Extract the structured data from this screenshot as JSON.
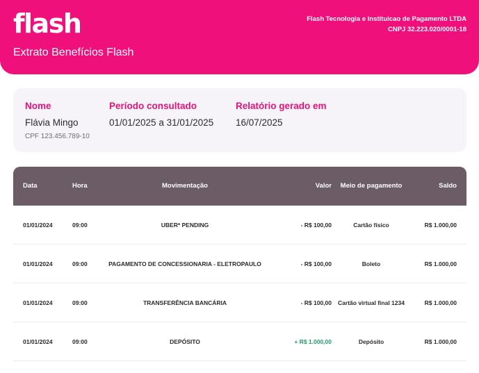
{
  "header": {
    "logo": "flash",
    "title": "Extrato Benefícios Flash",
    "company_name": "Flash Tecnologia e Instituicao de Pagamento LTDA",
    "company_cnpj": "CNPJ 32.223.020/0001-18",
    "brand_color": "#f0107c"
  },
  "info": {
    "name_label": "Nome",
    "name_value": "Flávia Mingo",
    "cpf": "CPF 123.456.789-10",
    "period_label": "Período consultado",
    "period_value": "01/01/2025 a 31/01/2025",
    "generated_label": "Relatório gerado em",
    "generated_value": "16/07/2025",
    "label_color": "#e5127a"
  },
  "table": {
    "header_color": "#6b5c66",
    "columns": [
      "Data",
      "Hora",
      "Movimentação",
      "Valor",
      "Meio de pagamento",
      "Saldo"
    ],
    "rows": [
      {
        "data": "01/01/2024",
        "hora": "09:00",
        "movimentacao": "UBER* PENDING",
        "valor": "- R$ 100,00",
        "meio": "Cartão físico",
        "saldo": "R$ 1.000,00"
      },
      {
        "data": "01/01/2024",
        "hora": "09:00",
        "movimentacao": "PAGAMENTO DE CONCESSIONARIA - ELETROPAULO",
        "valor": "- R$ 100,00",
        "meio": "Boleto",
        "saldo": "R$ 1.000,00"
      },
      {
        "data": "01/01/2024",
        "hora": "09:00",
        "movimentacao": "TRANSFERÊNCIA BANCÁRIA",
        "valor": "- R$ 100,00",
        "meio": "Cartão virtual final 1234",
        "saldo": "R$ 1.000,00"
      },
      {
        "data": "01/01/2024",
        "hora": "09:00",
        "movimentacao": "DEPÓSITO",
        "valor": "+ R$ 1.000,00",
        "meio": "Depósito",
        "saldo": "R$ 1.000,00"
      }
    ],
    "positive_color": "#1f9d6b"
  }
}
